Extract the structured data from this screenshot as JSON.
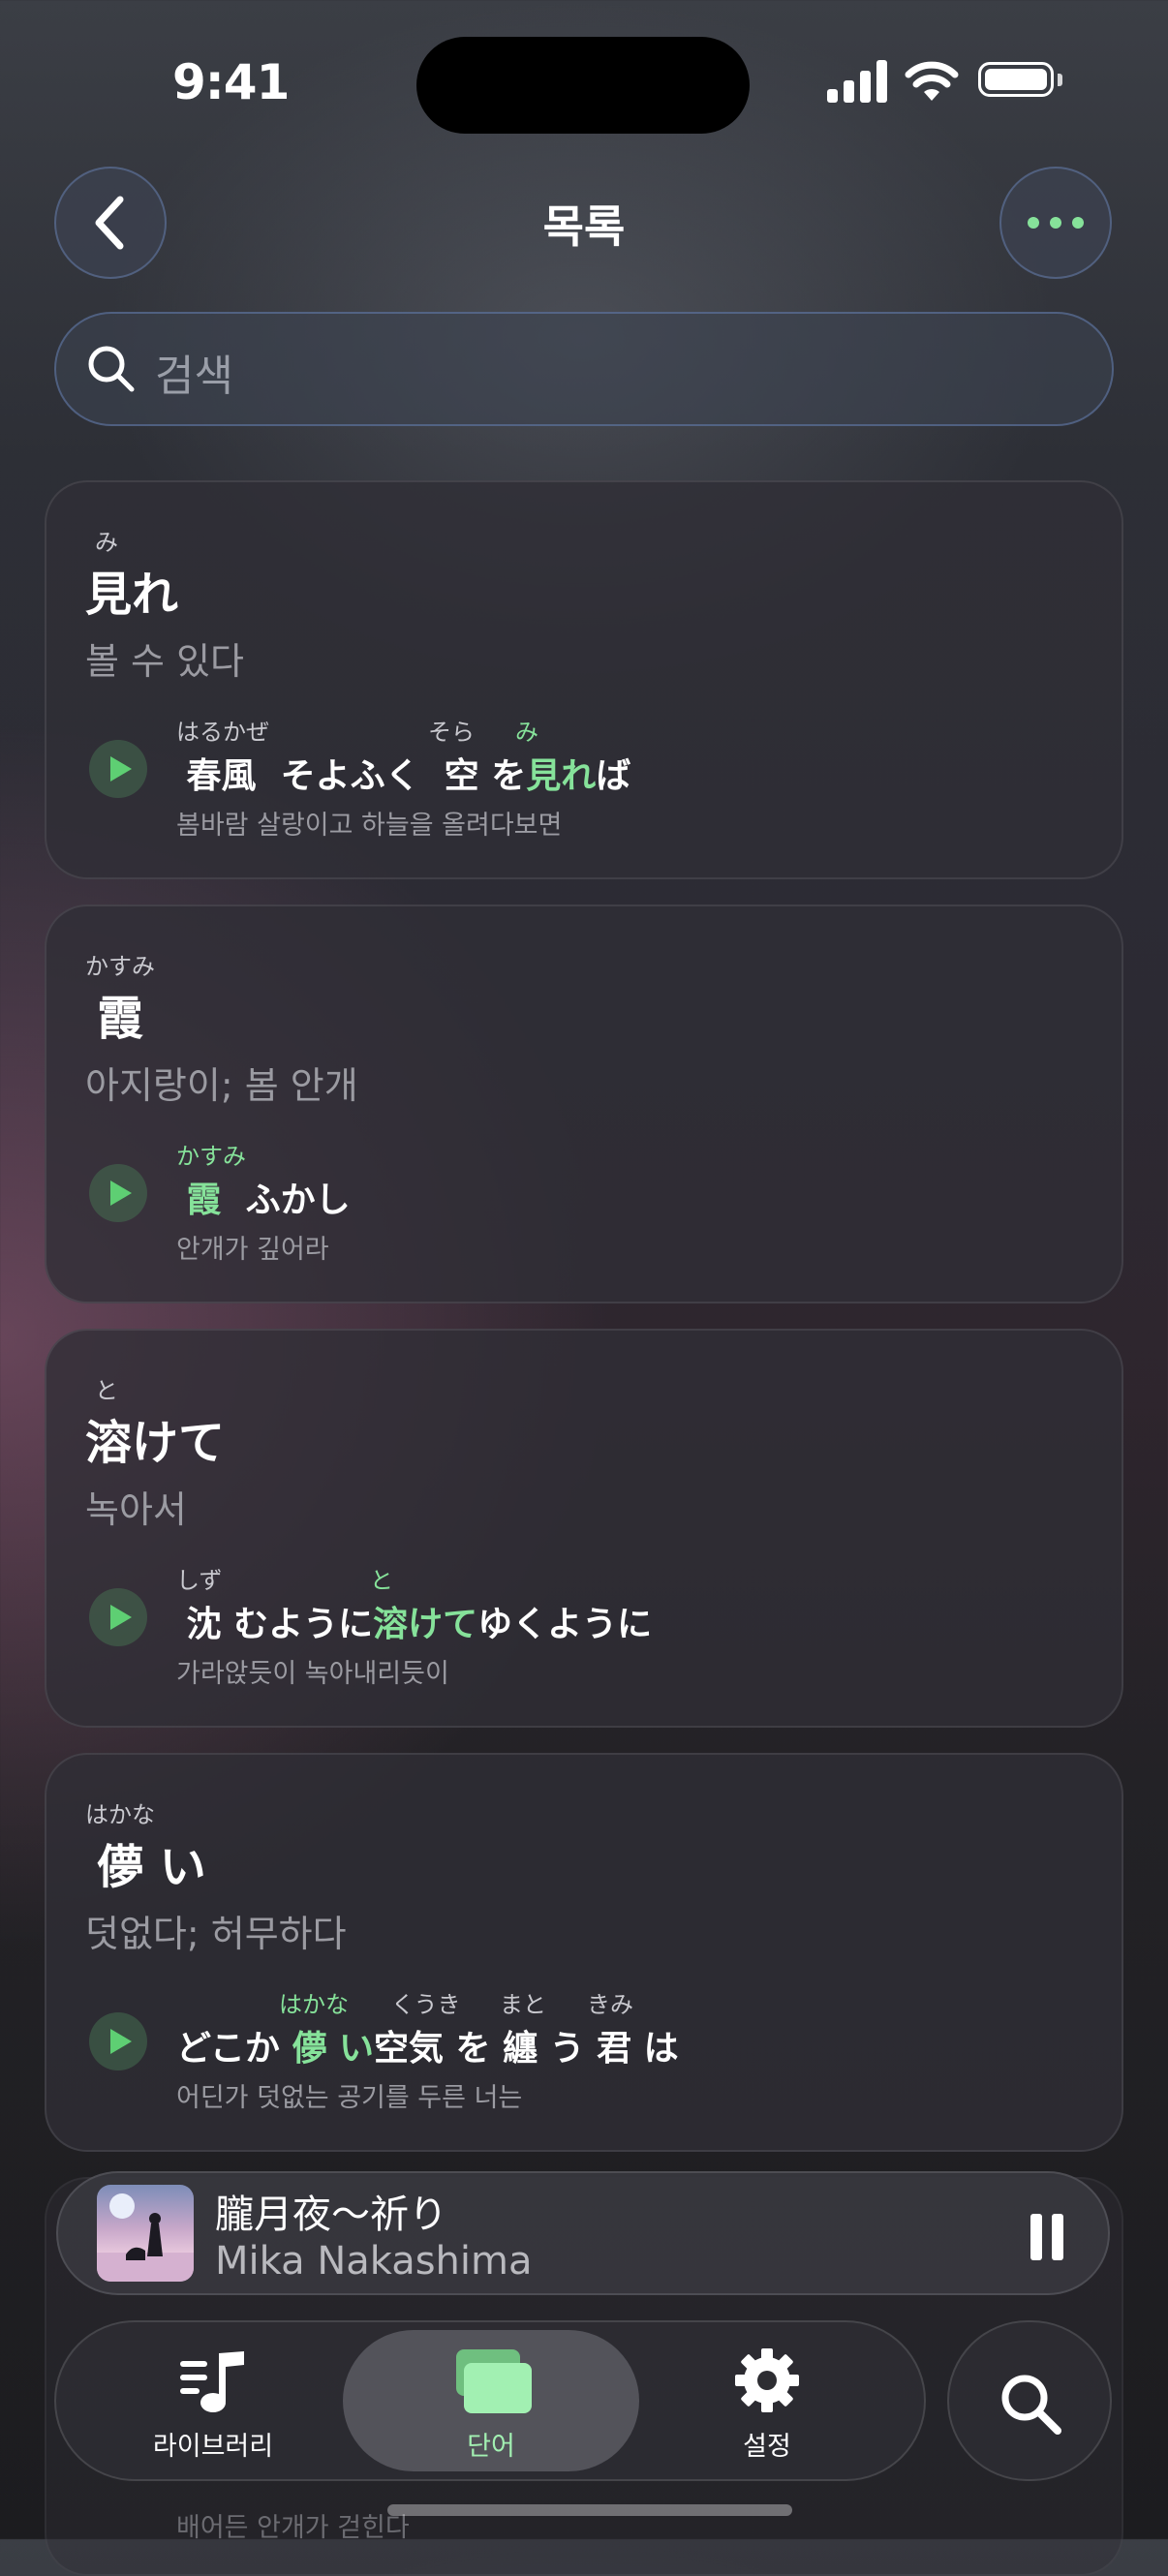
{
  "status_bar": {
    "time": "9:41"
  },
  "header": {
    "title": "목록"
  },
  "search": {
    "placeholder": "검색"
  },
  "cards": [
    {
      "reading": "み",
      "word": "見れ",
      "meaning": "볼 수 있다",
      "sentence_rubies": [
        "はるかぜ",
        "そら",
        "み"
      ],
      "sentence_parts": [
        " 春風  そよふく  空 を",
        "見れ",
        "ば"
      ],
      "translation": "봄바람 살랑이고 하늘을 올려다보면"
    },
    {
      "reading": "かすみ",
      "word": "霞",
      "meaning": "아지랑이; 봄 안개",
      "sentence_rubies": [
        "かすみ"
      ],
      "sentence_parts": [
        " 霞 ",
        " ふかし"
      ],
      "translation": "안개가 깊어라"
    },
    {
      "reading": "と",
      "word": "溶けて",
      "meaning": "녹아서",
      "sentence_rubies": [
        "しず",
        "と"
      ],
      "sentence_parts": [
        " 沈 むように",
        "溶けて",
        "ゆくように"
      ],
      "translation": "가라앉듯이 녹아내리듯이"
    },
    {
      "reading": "はかな",
      "word": "儚 い",
      "meaning": "덧없다; 허무하다",
      "sentence_rubies": [
        "はかな",
        "くうき",
        "まと",
        "きみ"
      ],
      "sentence_parts": [
        "どこか ",
        "儚 い",
        "空気 を 纏 う 君 は"
      ],
      "translation": "어딘가 덧없는 공기를 두른 너는"
    }
  ],
  "behind_peek": {
    "translation": "배어든 안개가 걷힌다"
  },
  "now_playing": {
    "title": "朧月夜～祈り",
    "artist": "Mika Nakashima",
    "state": "playing"
  },
  "tabs": [
    {
      "label": "라이브러리",
      "icon": "music-library-icon"
    },
    {
      "label": "단어",
      "icon": "cards-icon",
      "active": true
    },
    {
      "label": "설정",
      "icon": "gear-icon"
    }
  ],
  "colors": {
    "accent": "#86e29a",
    "play": "#5ecf73"
  }
}
